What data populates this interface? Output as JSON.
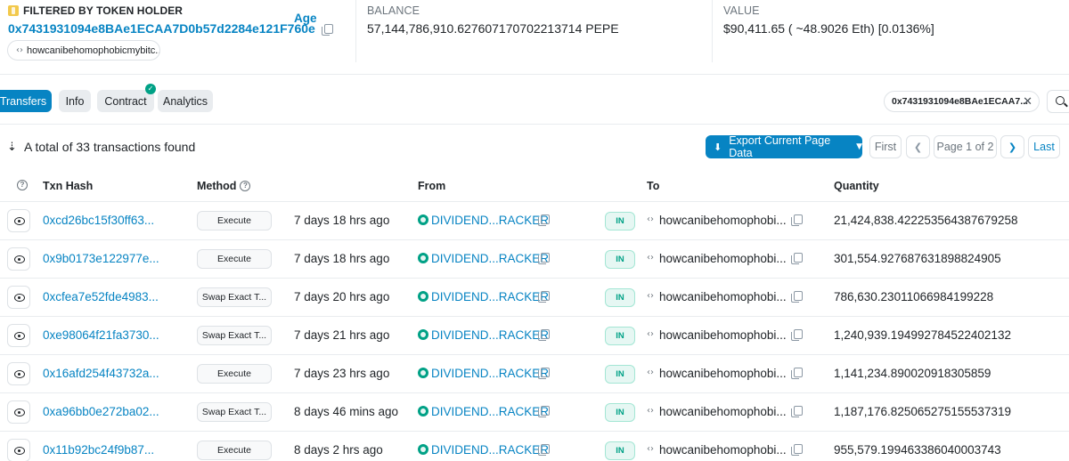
{
  "summary": {
    "filter_label": "FILTERED BY TOKEN HOLDER",
    "holder_address": "0x7431931094e8BAe1ECAA7D0b57d2284e121F760e",
    "holder_name_tag": "howcanibehomophobicmybitc...",
    "balance_label": "BALANCE",
    "balance_value": "57,144,786,910.627607170702213714 PEPE",
    "value_label": "VALUE",
    "value_text": "$90,411.65 ( ~48.9026 Eth) [0.0136%]"
  },
  "tabs": [
    {
      "label": "Transfers",
      "active": true
    },
    {
      "label": "Info",
      "active": false
    },
    {
      "label": "Contract",
      "active": false,
      "verified": true
    },
    {
      "label": "Analytics",
      "active": false
    }
  ],
  "filter_pill": "0x7431931094e8BAe1ECAA7...",
  "toolbar": {
    "total_text": "A total of 33 transactions found",
    "export_label": "Export Current Page Data",
    "pagination": {
      "first": "First",
      "page_info": "Page 1 of 2",
      "last": "Last"
    }
  },
  "table": {
    "headers": {
      "txn_hash": "Txn Hash",
      "method": "Method",
      "age": "Age",
      "from": "From",
      "to": "To",
      "quantity": "Quantity"
    },
    "rows": [
      {
        "hash": "0xcd26bc15f30ff63...",
        "method": "Execute",
        "age": "7 days 18 hrs ago",
        "from": "DIVIDEND...RACKER",
        "direction": "IN",
        "to": "howcanibehomophobi...",
        "quantity": "21,424,838.422253564387679258"
      },
      {
        "hash": "0x9b0173e122977e...",
        "method": "Execute",
        "age": "7 days 18 hrs ago",
        "from": "DIVIDEND...RACKER",
        "direction": "IN",
        "to": "howcanibehomophobi...",
        "quantity": "301,554.927687631898824905"
      },
      {
        "hash": "0xcfea7e52fde4983...",
        "method": "Swap Exact T...",
        "age": "7 days 20 hrs ago",
        "from": "DIVIDEND...RACKER",
        "direction": "IN",
        "to": "howcanibehomophobi...",
        "quantity": "786,630.23011066984199228"
      },
      {
        "hash": "0xe98064f21fa3730...",
        "method": "Swap Exact T...",
        "age": "7 days 21 hrs ago",
        "from": "DIVIDEND...RACKER",
        "direction": "IN",
        "to": "howcanibehomophobi...",
        "quantity": "1,240,939.194992784522402132"
      },
      {
        "hash": "0x16afd254f43732a...",
        "method": "Execute",
        "age": "7 days 23 hrs ago",
        "from": "DIVIDEND...RACKER",
        "direction": "IN",
        "to": "howcanibehomophobi...",
        "quantity": "1,141,234.890020918305859"
      },
      {
        "hash": "0xa96bb0e272ba02...",
        "method": "Swap Exact T...",
        "age": "8 days 46 mins ago",
        "from": "DIVIDEND...RACKER",
        "direction": "IN",
        "to": "howcanibehomophobi...",
        "quantity": "1,187,176.825065275155537319"
      },
      {
        "hash": "0x11b92bc24f9b87...",
        "method": "Execute",
        "age": "8 days 2 hrs ago",
        "from": "DIVIDEND...RACKER",
        "direction": "IN",
        "to": "howcanibehomophobi...",
        "quantity": "955,579.199463386040003743"
      }
    ]
  },
  "icons": {
    "token": "pepe-coin-icon",
    "copy": "copy-icon",
    "code": "contract-code-icon",
    "verified": "check-circle-icon",
    "close": "close-icon",
    "search": "search-icon",
    "sort": "sort-icon",
    "download": "download-icon",
    "view": "eye-icon",
    "help": "question-circle-icon",
    "sender": "dividend-tracker-icon"
  },
  "colors": {
    "accent": "#0784c3",
    "success": "#00a186",
    "muted": "#6c757d",
    "border": "#dee2e6"
  }
}
